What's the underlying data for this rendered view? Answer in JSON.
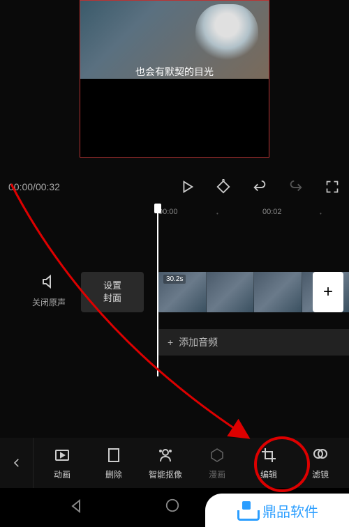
{
  "preview": {
    "subtitle": "也会有默契的目光"
  },
  "transport": {
    "current_time": "00:00",
    "total_time": "00:32"
  },
  "ruler": {
    "ticks": [
      "00:00",
      "00:02"
    ]
  },
  "mute": {
    "label": "关闭原声"
  },
  "cover": {
    "label_line1": "设置",
    "label_line2": "封面"
  },
  "clip": {
    "duration": "30.2s"
  },
  "audio": {
    "label": "添加音频"
  },
  "toolbar": {
    "items": [
      {
        "label": "动画",
        "name": "animation"
      },
      {
        "label": "删除",
        "name": "delete"
      },
      {
        "label": "智能抠像",
        "name": "smart-cutout"
      },
      {
        "label": "漫画",
        "name": "comic"
      },
      {
        "label": "编辑",
        "name": "edit"
      },
      {
        "label": "滤镜",
        "name": "filter"
      }
    ]
  },
  "watermark": {
    "text": "鼎品软件"
  }
}
